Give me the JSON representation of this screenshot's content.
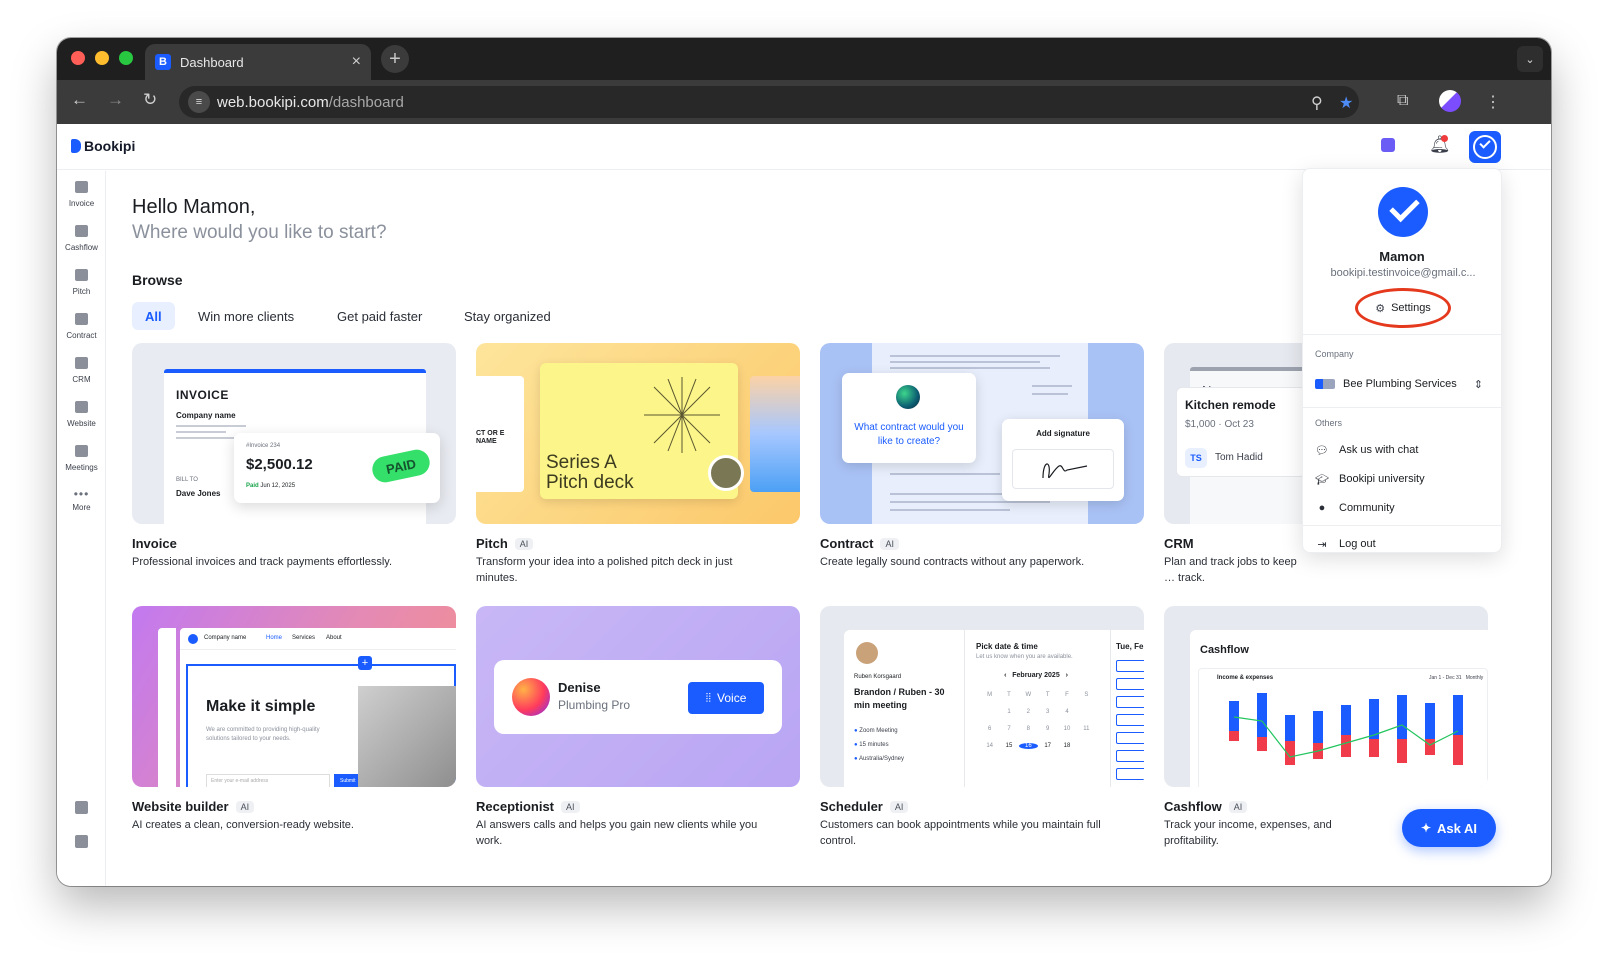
{
  "browser": {
    "tab_title": "Dashboard",
    "url_host": "web.bookipi.com",
    "url_path": "/dashboard"
  },
  "app": {
    "logo": "Bookipi",
    "brand_color": "#1a5cff"
  },
  "sidebar": {
    "items": [
      {
        "label": "Invoice",
        "icon": "invoice-icon"
      },
      {
        "label": "Cashflow",
        "icon": "cashflow-icon"
      },
      {
        "label": "Pitch",
        "icon": "pitch-icon"
      },
      {
        "label": "Contract",
        "icon": "contract-icon"
      },
      {
        "label": "CRM",
        "icon": "crm-icon"
      },
      {
        "label": "Website",
        "icon": "website-icon"
      },
      {
        "label": "Meetings",
        "icon": "meetings-icon"
      },
      {
        "label": "More",
        "icon": "more-icon"
      }
    ]
  },
  "main": {
    "greeting": "Hello Mamon,",
    "subgreeting": "Where would you like to start?",
    "browse_label": "Browse",
    "filters": [
      "All",
      "Win more clients",
      "Get paid faster",
      "Stay organized"
    ],
    "active_filter": "All"
  },
  "cards": [
    {
      "title": "Invoice",
      "ai": false,
      "desc": "Professional invoices and track payments effortlessly."
    },
    {
      "title": "Pitch",
      "ai": true,
      "desc": "Transform your idea into a polished pitch deck in just minutes."
    },
    {
      "title": "Contract",
      "ai": true,
      "desc": "Create legally sound contracts without any paperwork."
    },
    {
      "title": "CRM",
      "ai": false,
      "desc": "Plan and track jobs to keep … track."
    },
    {
      "title": "Website builder",
      "ai": true,
      "desc": "AI creates a clean, conversion-ready website."
    },
    {
      "title": "Receptionist",
      "ai": true,
      "desc": "AI answers calls and helps you gain new clients while you work."
    },
    {
      "title": "Scheduler",
      "ai": true,
      "desc": "Customers can book appointments while you maintain full control."
    },
    {
      "title": "Cashflow",
      "ai": true,
      "desc": "Track your income, expenses, and profitability."
    }
  ],
  "ai_tag": "AI",
  "thumbs": {
    "invoice": {
      "heading": "INVOICE",
      "company": "Company name",
      "bill_to": "BILL TO",
      "client": "Dave Jones",
      "number": "#Invoice 234",
      "amount": "$2,500.12",
      "paid_label": "Paid",
      "paid_date": "Jun 12, 2025",
      "stamp": "PAID"
    },
    "pitch": {
      "title_line1": "Series A",
      "title_line2": "Pitch deck",
      "side_text": "CT OR E NAME"
    },
    "contract": {
      "question": "What contract would you like to create?",
      "signature_title": "Add signature"
    },
    "crm": {
      "column": "New",
      "job": "Kitchen remode",
      "meta": "$1,000 · Oct 23",
      "initials": "TS",
      "person": "Tom Hadid"
    },
    "website": {
      "company": "Company name",
      "nav": [
        "Home",
        "Services",
        "About"
      ],
      "hero": "Make it simple",
      "hero_sub": "We are committed to providing high-quality solutions tailored to your needs.",
      "email_placeholder": "Enter your e-mail address",
      "submit": "Submit"
    },
    "receptionist": {
      "name": "Denise",
      "company": "Plumbing Pro",
      "voice": "Voice"
    },
    "scheduler": {
      "host": "Ruben Korsgaard",
      "meeting": "Brandon / Ruben - 30 min meeting",
      "zoom": "Zoom Meeting",
      "duration": "15 minutes",
      "timezone": "Australia/Sydney",
      "pick": "Pick date & time",
      "pick_sub": "Let us know when you are available.",
      "month": "February 2025",
      "day_header": "Tue, Fe"
    },
    "cashflow": {
      "title": "Cashflow",
      "chart_label": "Income & expenses",
      "range": "Jan 1 - Dec 31",
      "period": "Monthly"
    }
  },
  "profile": {
    "name": "Mamon",
    "email": "bookipi.testinvoice@gmail.c...",
    "settings": "Settings",
    "company_label": "Company",
    "company": "Bee Plumbing Services",
    "others_label": "Others",
    "others": [
      "Ask us with chat",
      "Bookipi university",
      "Community"
    ],
    "logout": "Log out",
    "highlight_color": "#e5391d"
  },
  "ask_ai": "Ask AI"
}
